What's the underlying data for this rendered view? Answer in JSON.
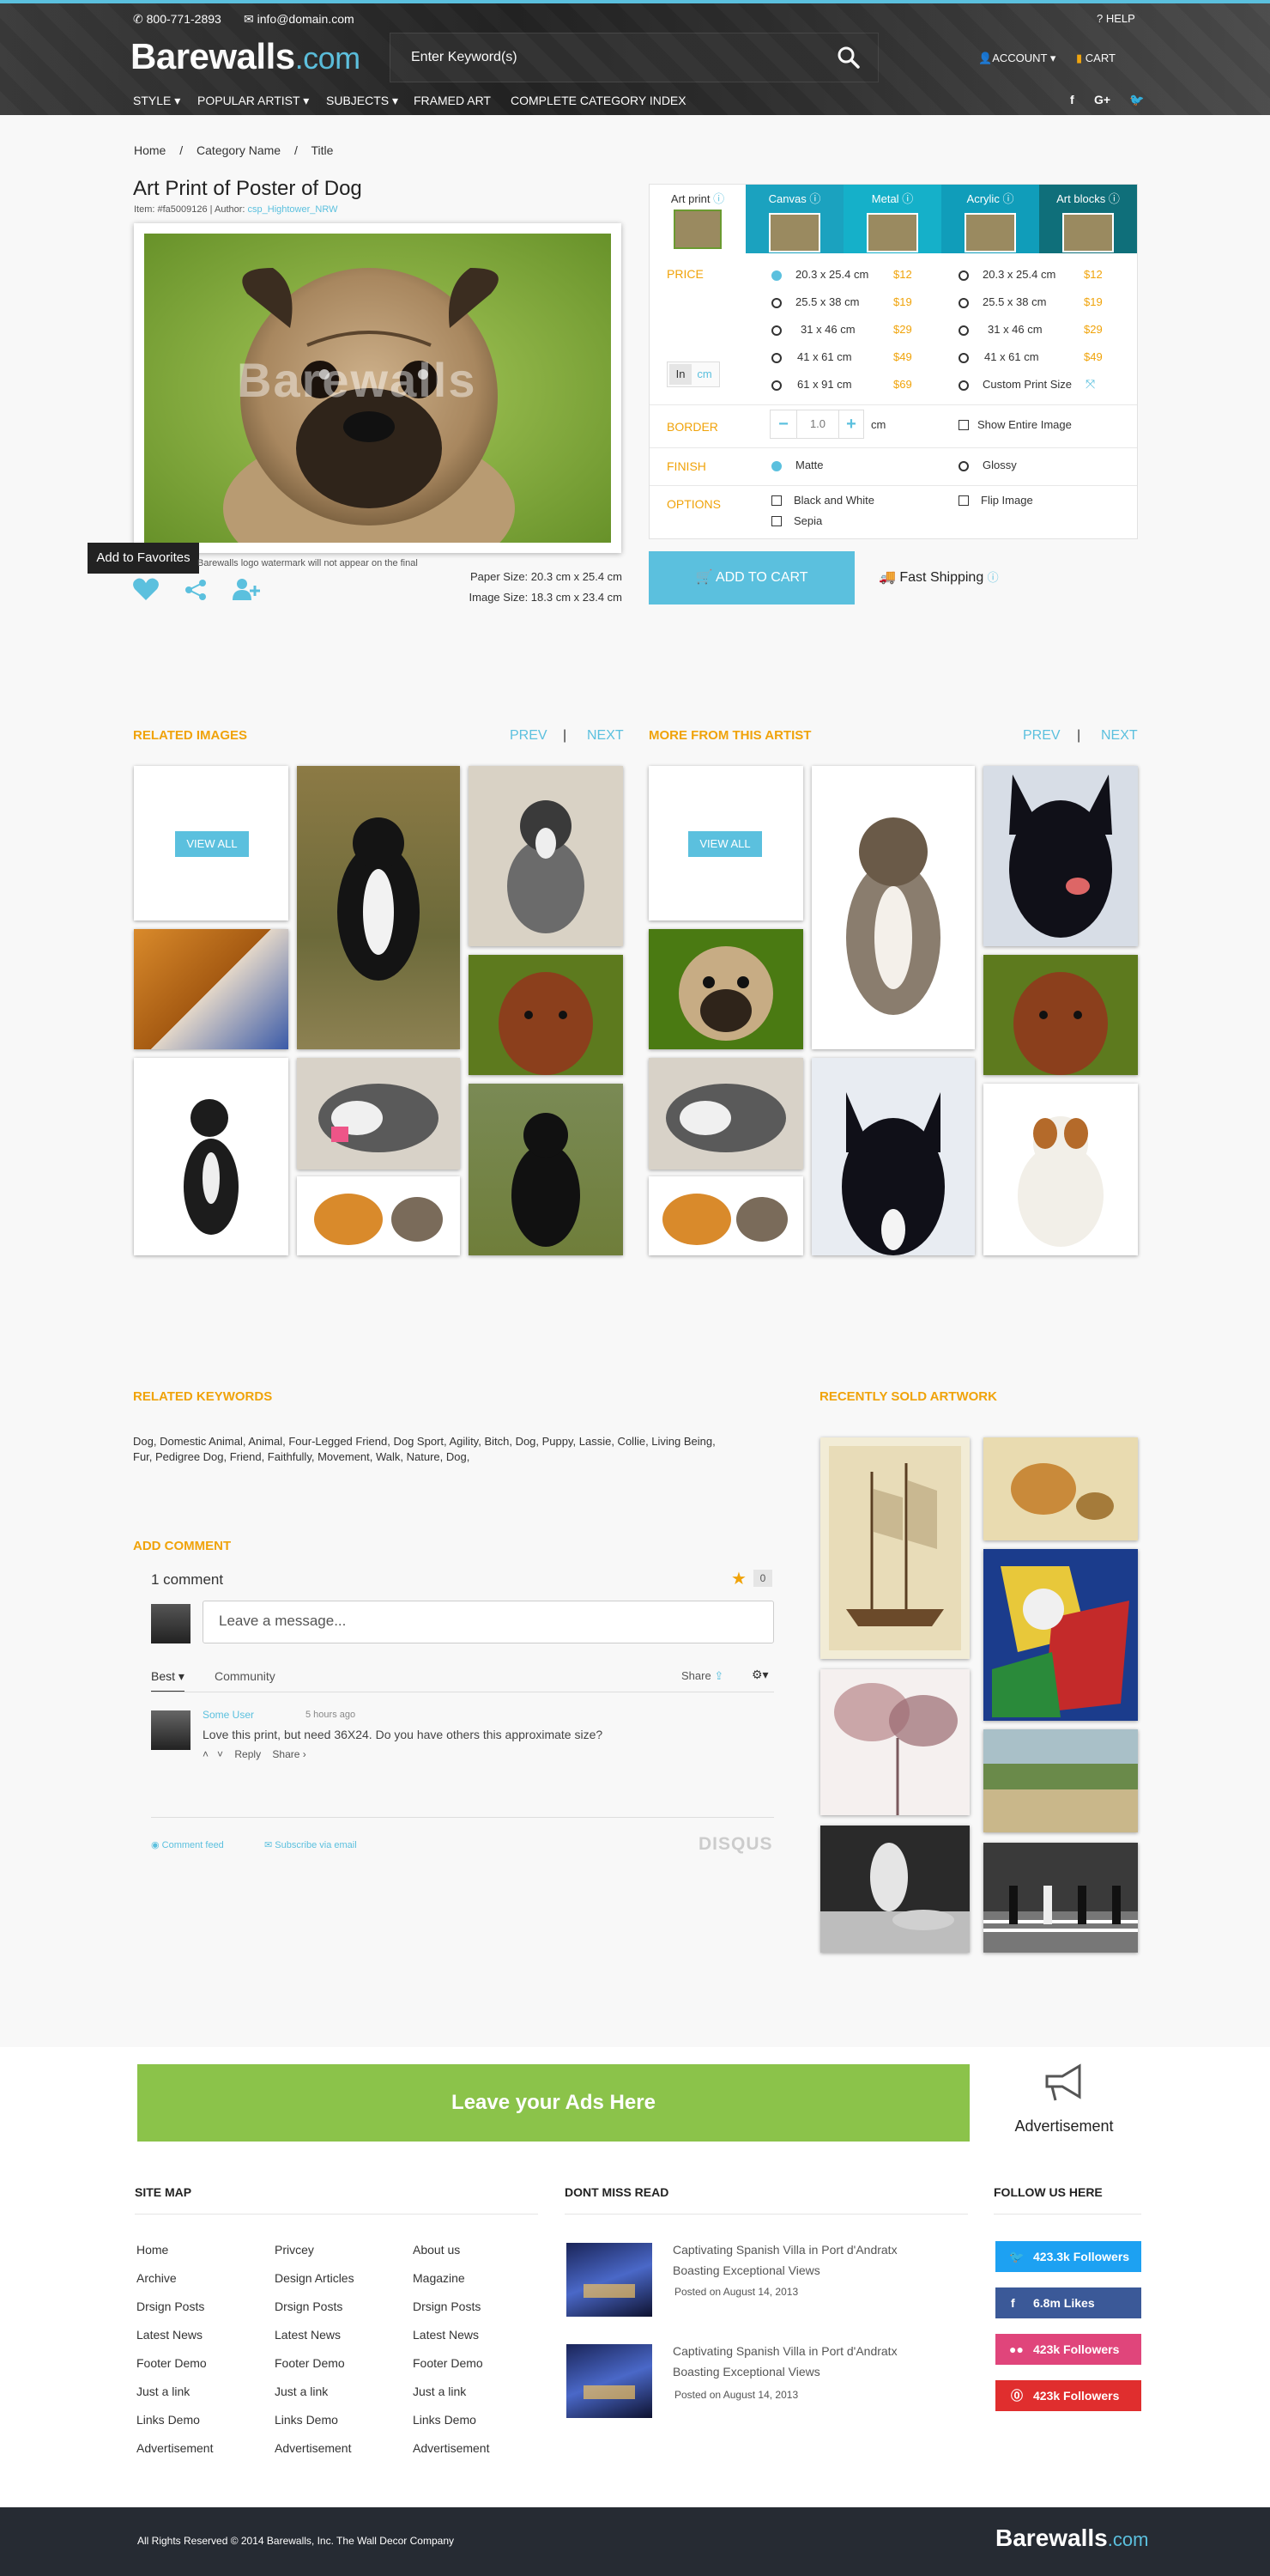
{
  "header": {
    "phone": "800-771-2893",
    "email": "info@domain.com",
    "help": "HELP",
    "logo_main": "Barewalls",
    "logo_suffix": ".com",
    "search_placeholder": "Enter Keyword(s)",
    "account": "ACCOUNT",
    "cart": "CART",
    "nav": [
      "STYLE",
      "POPULAR ARTIST",
      "SUBJECTS",
      "FRAMED ART",
      "COMPLETE CATEGORY INDEX"
    ]
  },
  "breadcrumb": [
    "Home",
    "Category Name",
    "Title"
  ],
  "product": {
    "title": "Art Print of Poster of Dog",
    "item_prefix": "Item: #fa5009126 | Author: ",
    "author": "csp_Hightower_NRW",
    "watermark": "Barewalls",
    "tooltip": "Add to Favorites",
    "watermark_note": "Barewalls logo watermark will not appear on the final",
    "paper_size": "Paper Size: 20.3 cm  x 25.4 cm",
    "image_size": "Image Size: 18.3 cm x 23.4 cm"
  },
  "options": {
    "tabs": [
      "Art print",
      "Canvas",
      "Metal",
      "Acrylic",
      "Art blocks"
    ],
    "price_label": "PRICE",
    "sizes_left": [
      {
        "size": "20.3 x 25.4 cm",
        "price": "$12"
      },
      {
        "size": "25.5 x 38 cm",
        "price": "$19"
      },
      {
        "size": "31 x 46 cm",
        "price": "$29"
      },
      {
        "size": "41 x 61 cm",
        "price": "$49"
      },
      {
        "size": "61 x 91 cm",
        "price": "$69"
      }
    ],
    "sizes_right": [
      {
        "size": "20.3 x 25.4 cm",
        "price": "$12"
      },
      {
        "size": "25.5 x 38 cm",
        "price": "$19"
      },
      {
        "size": "31 x 46 cm",
        "price": "$29"
      },
      {
        "size": "41 x 61 cm",
        "price": "$49"
      },
      {
        "size": "Custom Print Size",
        "price": ""
      }
    ],
    "unit_in": "In",
    "unit_cm": "cm",
    "border_label": "BORDER",
    "border_value": "1.0",
    "border_unit": "cm",
    "show_entire": "Show Entire Image",
    "finish_label": "FINISH",
    "finish_matte": "Matte",
    "finish_glossy": "Glossy",
    "options_label": "OPTIONS",
    "opt_bw": "Black and White",
    "opt_sepia": "Sepia",
    "opt_flip": "Flip Image"
  },
  "cart_button": "ADD TO CART",
  "shipping": "Fast Shipping",
  "related": {
    "title": "RELATED IMAGES",
    "prev": "PREV",
    "sep": "|",
    "next": "NEXT",
    "view_all": "VIEW ALL"
  },
  "artist": {
    "title": "MORE FROM THIS ARTIST",
    "prev": "PREV",
    "sep": "|",
    "next": "NEXT",
    "view_all": "VIEW ALL"
  },
  "keywords": {
    "title": "RELATED KEYWORDS",
    "line1": "Dog, Domestic Animal, Animal, Four-Legged Friend, Dog Sport, Agility, Bitch, Dog, Puppy, Lassie, Collie, Living Being,",
    "line2": "Fur, Pedigree Dog, Friend, Faithfully, Movement, Walk, Nature, Dog,"
  },
  "recently_sold": "RECENTLY SOLD ARTWORK",
  "comments": {
    "title": "ADD COMMENT",
    "count": "1 comment",
    "star_count": "0",
    "placeholder": "Leave a message...",
    "tab_best": "Best",
    "tab_community": "Community",
    "share": "Share",
    "user": "Some User",
    "time": "5 hours ago",
    "text": "Love this print, but need 36X24.  Do you have others this approximate size?",
    "reply": "Reply",
    "share2": "Share ›",
    "feed": "Comment feed",
    "subscribe": "Subscribe via email",
    "disqus": "DISQUS"
  },
  "ads": {
    "banner": "Leave your Ads Here",
    "label": "Advertisement"
  },
  "footer": {
    "sitemap_title": "SITE MAP",
    "col1": [
      "Home",
      "Archive",
      "Drsign Posts",
      "Latest News",
      "Footer Demo",
      "Just a link",
      "Links Demo",
      "Advertisement"
    ],
    "col2": [
      "Privcey",
      "Design Articles",
      "Drsign Posts",
      "Latest News",
      "Footer Demo",
      "Just a link",
      "Links Demo",
      "Advertisement"
    ],
    "col3": [
      "About us",
      "Magazine",
      "Drsign Posts",
      "Latest News",
      "Footer Demo",
      "Just a link",
      "Links Demo",
      "Advertisement"
    ],
    "dont_miss_title": "DONT MISS READ",
    "articles": [
      {
        "title1": "Captivating Spanish Villa in Port d'Andratx",
        "title2": "Boasting Exceptional Views",
        "date": "Posted on August 14, 2013"
      },
      {
        "title1": "Captivating Spanish Villa in Port d'Andratx",
        "title2": "Boasting Exceptional Views",
        "date": "Posted on August 14, 2013"
      }
    ],
    "follow_title": "FOLLOW US HERE",
    "twitter": "423.3k Followers",
    "facebook": "6.8m Likes",
    "flickr": "423k Followers",
    "pinterest": "423k Followers",
    "copyright": "All Rights Reserved © 2014  Barewalls, Inc. The Wall Decor Company",
    "logo_main": "Barewalls",
    "logo_suffix": ".com"
  },
  "colors": {
    "accent": "#5bc0de",
    "orange": "#f0a30a",
    "teal_dark": "#0f6f7a",
    "ad_green": "#8bc34a",
    "twitter": "#1da1f2",
    "facebook": "#3b5998",
    "flickr": "#e0457b",
    "pinterest": "#e02e2e"
  }
}
